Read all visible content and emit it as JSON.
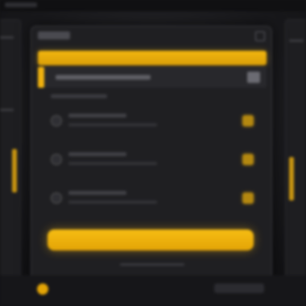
{
  "window": {
    "title": "",
    "maximize_icon": "maximize-icon"
  },
  "highlight": {
    "label": ""
  },
  "selected": {
    "label": ""
  },
  "rows": [
    {
      "title": "",
      "icon": "circle-icon",
      "badge_color": "#b48810"
    },
    {
      "title": "",
      "icon": "circle-icon",
      "badge_color": "#b48810"
    },
    {
      "title": "",
      "icon": "circle-icon",
      "badge_color": "#b48810"
    }
  ],
  "cta": {
    "label": ""
  },
  "status": {
    "text": "",
    "accent_color": "#e3a406"
  },
  "colors": {
    "accent": "#f0b20e",
    "background": "#1f1f22",
    "panel_border": "#38383d"
  }
}
